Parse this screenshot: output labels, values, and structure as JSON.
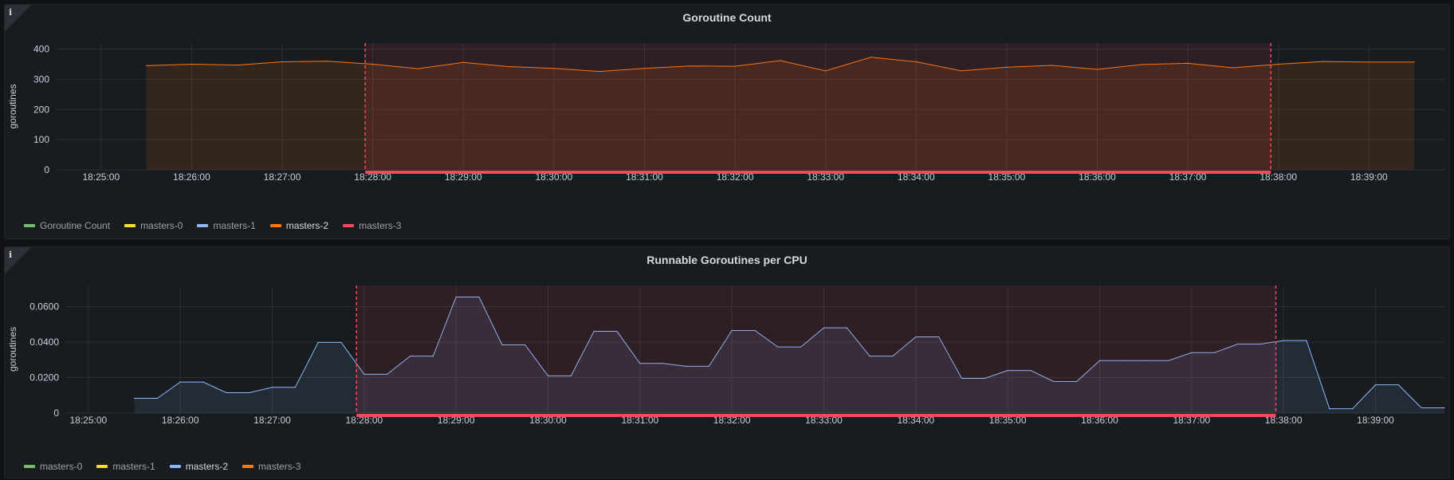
{
  "chart_data": [
    {
      "type": "area",
      "title": "Goroutine Count",
      "ylabel": "goroutines",
      "ylim": [
        0,
        420
      ],
      "yticks": [
        0,
        100,
        200,
        300,
        400
      ],
      "x_ticks": [
        "18:25:00",
        "18:26:00",
        "18:27:00",
        "18:28:00",
        "18:29:00",
        "18:30:00",
        "18:31:00",
        "18:32:00",
        "18:33:00",
        "18:34:00",
        "18:35:00",
        "18:36:00",
        "18:37:00",
        "18:38:00",
        "18:39:00"
      ],
      "time_range": [
        "18:24:30",
        "18:39:50"
      ],
      "annotation_region": {
        "start": "18:27:55",
        "end": "18:37:55",
        "color": "#f2495c"
      },
      "series": [
        {
          "name": "masters-2",
          "color": "#ff780a",
          "x": [
            "18:25:30",
            "18:26:00",
            "18:26:30",
            "18:27:00",
            "18:27:30",
            "18:28:00",
            "18:28:30",
            "18:29:00",
            "18:29:30",
            "18:30:00",
            "18:30:30",
            "18:31:00",
            "18:31:30",
            "18:32:00",
            "18:32:30",
            "18:33:00",
            "18:33:30",
            "18:34:00",
            "18:34:30",
            "18:35:00",
            "18:35:30",
            "18:36:00",
            "18:36:30",
            "18:37:00",
            "18:37:30",
            "18:38:00",
            "18:38:30",
            "18:39:00",
            "18:39:30"
          ],
          "values": [
            345,
            350,
            347,
            358,
            360,
            350,
            335,
            356,
            342,
            336,
            326,
            336,
            344,
            343,
            362,
            328,
            373,
            358,
            328,
            340,
            346,
            333,
            349,
            353,
            338,
            350,
            359,
            357,
            357
          ]
        }
      ],
      "legend": [
        {
          "name": "Goroutine Count",
          "color": "#73bf69",
          "active": false
        },
        {
          "name": "masters-0",
          "color": "#fade2a",
          "active": false
        },
        {
          "name": "masters-1",
          "color": "#8ab8ff",
          "active": false
        },
        {
          "name": "masters-2",
          "color": "#ff780a",
          "active": true
        },
        {
          "name": "masters-3",
          "color": "#f2495c",
          "active": false
        }
      ]
    },
    {
      "type": "area",
      "title": "Runnable Goroutines per CPU",
      "ylabel": "goroutines",
      "ylim": [
        0,
        0.072
      ],
      "yticks": [
        0,
        0.02,
        0.04,
        0.06
      ],
      "ytick_labels": [
        "0",
        "0.0200",
        "0.0400",
        "0.0600"
      ],
      "x_ticks": [
        "18:25:00",
        "18:26:00",
        "18:27:00",
        "18:28:00",
        "18:29:00",
        "18:30:00",
        "18:31:00",
        "18:32:00",
        "18:33:00",
        "18:34:00",
        "18:35:00",
        "18:36:00",
        "18:37:00",
        "18:38:00",
        "18:39:00"
      ],
      "time_range": [
        "18:24:45",
        "18:39:45"
      ],
      "annotation_region": {
        "start": "18:27:55",
        "end": "18:37:55",
        "color": "#f2495c"
      },
      "series": [
        {
          "name": "masters-2",
          "color": "#8ab8ff",
          "x": [
            "18:25:30",
            "18:25:45",
            "18:26:00",
            "18:26:15",
            "18:26:30",
            "18:26:45",
            "18:27:00",
            "18:27:15",
            "18:27:30",
            "18:27:45",
            "18:28:00",
            "18:28:15",
            "18:28:30",
            "18:28:45",
            "18:29:00",
            "18:29:15",
            "18:29:30",
            "18:29:45",
            "18:30:00",
            "18:30:15",
            "18:30:30",
            "18:30:45",
            "18:31:00",
            "18:31:15",
            "18:31:30",
            "18:31:45",
            "18:32:00",
            "18:32:15",
            "18:32:30",
            "18:32:45",
            "18:33:00",
            "18:33:15",
            "18:33:30",
            "18:33:45",
            "18:34:00",
            "18:34:15",
            "18:34:30",
            "18:34:45",
            "18:35:00",
            "18:35:15",
            "18:35:30",
            "18:35:45",
            "18:36:00",
            "18:36:15",
            "18:36:30",
            "18:36:45",
            "18:37:00",
            "18:37:15",
            "18:37:30",
            "18:37:45",
            "18:38:00",
            "18:38:15",
            "18:38:30",
            "18:38:45",
            "18:39:00",
            "18:39:15",
            "18:39:30",
            "18:39:45"
          ],
          "values": [
            0.0083,
            0.0083,
            0.0175,
            0.0175,
            0.0115,
            0.0115,
            0.0145,
            0.0145,
            0.0399,
            0.0399,
            0.0219,
            0.0219,
            0.0321,
            0.0321,
            0.0655,
            0.0655,
            0.0385,
            0.0385,
            0.021,
            0.021,
            0.0461,
            0.0461,
            0.028,
            0.028,
            0.0264,
            0.0264,
            0.0466,
            0.0466,
            0.0373,
            0.0373,
            0.0481,
            0.0481,
            0.0321,
            0.0321,
            0.043,
            0.043,
            0.0196,
            0.0196,
            0.024,
            0.024,
            0.0178,
            0.0178,
            0.0296,
            0.0296,
            0.0296,
            0.0296,
            0.0341,
            0.0341,
            0.0389,
            0.0389,
            0.0409,
            0.0409,
            0.0024,
            0.0024,
            0.0159,
            0.0159,
            0.0029,
            0.0029
          ]
        }
      ],
      "legend": [
        {
          "name": "masters-0",
          "color": "#73bf69",
          "active": false
        },
        {
          "name": "masters-1",
          "color": "#fade2a",
          "active": false
        },
        {
          "name": "masters-2",
          "color": "#8ab8ff",
          "active": true
        },
        {
          "name": "masters-3",
          "color": "#ff780a",
          "active": false
        }
      ]
    }
  ]
}
